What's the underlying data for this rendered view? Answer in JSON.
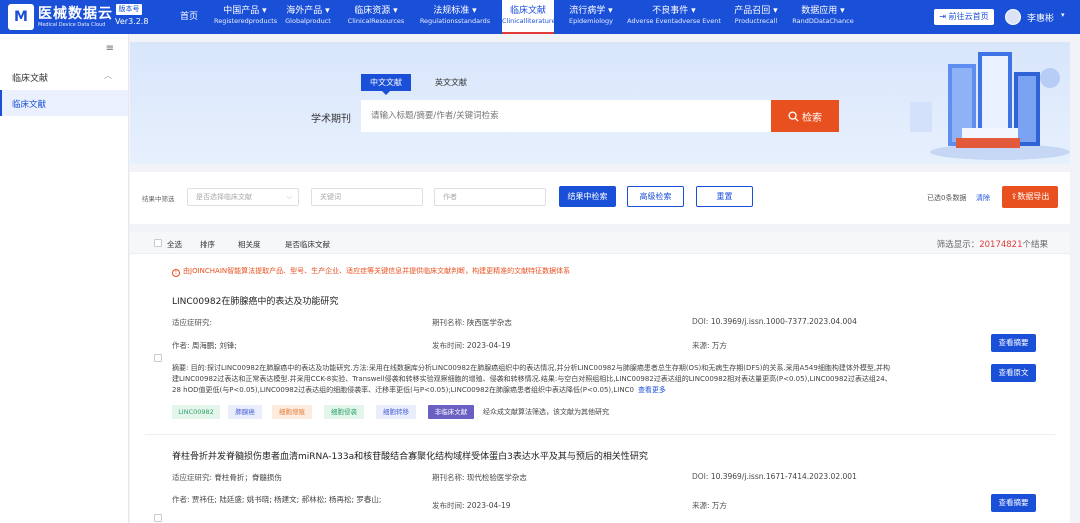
{
  "brand": {
    "logo_mark": "M",
    "name": "医械数据云",
    "tagline": "Medical Device Data Cloud",
    "version_tag": "版本号",
    "version": "Ver3.2.8"
  },
  "nav": [
    {
      "cn": "首页",
      "en": ""
    },
    {
      "cn": "中国产品 ▾",
      "en": "Registeredproducts"
    },
    {
      "cn": "海外产品 ▾",
      "en": "Globalproduct"
    },
    {
      "cn": "临床资源 ▾",
      "en": "ClinicalResources"
    },
    {
      "cn": "法规标准 ▾",
      "en": "Regulationsstandards"
    },
    {
      "cn": "临床文献",
      "en": "Clinicalliterature"
    },
    {
      "cn": "流行病学 ▾",
      "en": "Epidemiology"
    },
    {
      "cn": "不良事件 ▾",
      "en": "Adverse Eventadverse Event"
    },
    {
      "cn": "产品召回 ▾",
      "en": "Productrecall"
    },
    {
      "cn": "数据应用 ▾",
      "en": "RandDDataChance"
    }
  ],
  "header": {
    "home_button": "前往云首页",
    "user_name": "李惠彬",
    "user_caret": "▾"
  },
  "sidebar": {
    "toggle": "≡",
    "group": "临床文献",
    "group_caret": "︿",
    "item": "临床文献"
  },
  "search": {
    "tab_cn": "中文文献",
    "tab_en": "英文文献",
    "label": "学术期刊",
    "placeholder": "请输入标题/摘要/作者/关键词检索",
    "button": "检索"
  },
  "filter": {
    "label": "结果中筛选",
    "select_placeholder": "是否选择临床文献",
    "keyword_placeholder": "关键词",
    "author_placeholder": "作者",
    "search_in_results": "结果中检索",
    "advanced": "高级检索",
    "reset": "重置",
    "selected": "已选0条数据",
    "clear": "清除",
    "export": "数据导出"
  },
  "results_head": {
    "select_all": "全选",
    "sort": "排序",
    "relevance": "相关度",
    "is_clinical": "是否临床文献",
    "count_prefix": "筛选显示：",
    "count": "20174821",
    "count_suffix": "个结果"
  },
  "notice": "由JOINCHAIN智能算法提取产品、型号、生产企业、适应症等关键信息并提供临床文献判断，构建更精准的文献特征数据体系",
  "articles": [
    {
      "title": "LINC00982在肺腺癌中的表达及功能研究",
      "indication_label": "适应症研究:",
      "indication": "",
      "journal_label": "期刊名称:",
      "journal": "陕西医学杂志",
      "doi_label": "DOI:",
      "doi": "10.3969/j.issn.1000-7377.2023.04.004",
      "author_label": "作者:",
      "authors": "周海鹏; 刘锋;",
      "date_label": "发布时间:",
      "date": "2023-04-19",
      "source_label": "来源:",
      "source": "万方",
      "abstract_label": "摘要:",
      "abstract": "目的:探讨LINC00982在肺腺癌中的表达及功能研究.方法:采用在线数据库分析LINC00982在肺腺癌组织中的表达情况,并分析LINC00982与肺腺癌患者总生存期(OS)和无病生存期(DFS)的关系.采用A549细胞构建体外模型,并构建LINC00982过表达和正常表达模型.并采用CCK-8实验、Transwell侵袭和转移实验观察细胞的增殖、侵袭和转移情况.结果:与空白对照组相比,LINC00982过表达组的LINC00982相对表达量更高(P<0.05),LINC00982过表达组24、28 hOD值更低(与P<0.05),LINC00982过表达组的细胞侵袭率、迁移率更低(与P<0.05);LINC00982在肺腺癌患者组织中表达降低(P<0.05),LINC0",
      "more": "查看更多",
      "btn_abstract": "查看摘要",
      "btn_full": "查看原文",
      "tags": [
        "LINC00982",
        "肺腺癌",
        "细胞增殖",
        "细胞侵袭",
        "细胞转移",
        "非临床文献"
      ],
      "tag_note": "经众成文献算法筛选，该文献为其他研究"
    },
    {
      "title": "脊柱骨折并发脊髓损伤患者血清miRNA-133a和核苷酸结合寡聚化结构域样受体蛋白3表达水平及其与预后的相关性研究",
      "indication_label": "适应症研究:",
      "indication": "脊柱骨折；脊髓损伤",
      "journal_label": "期刊名称:",
      "journal": "现代检验医学杂志",
      "doi_label": "DOI:",
      "doi": "10.3969/j.issn.1671-7414.2023.02.001",
      "author_label": "作者:",
      "authors": "贾祎任; 陆廷盛; 姚书晓; 杨建文; 郝林松; 杨再松; 罗春山;",
      "date_label": "发布时间:",
      "date": "2023-04-19",
      "source_label": "来源:",
      "source": "万方",
      "btn_abstract": "查看摘要"
    }
  ]
}
